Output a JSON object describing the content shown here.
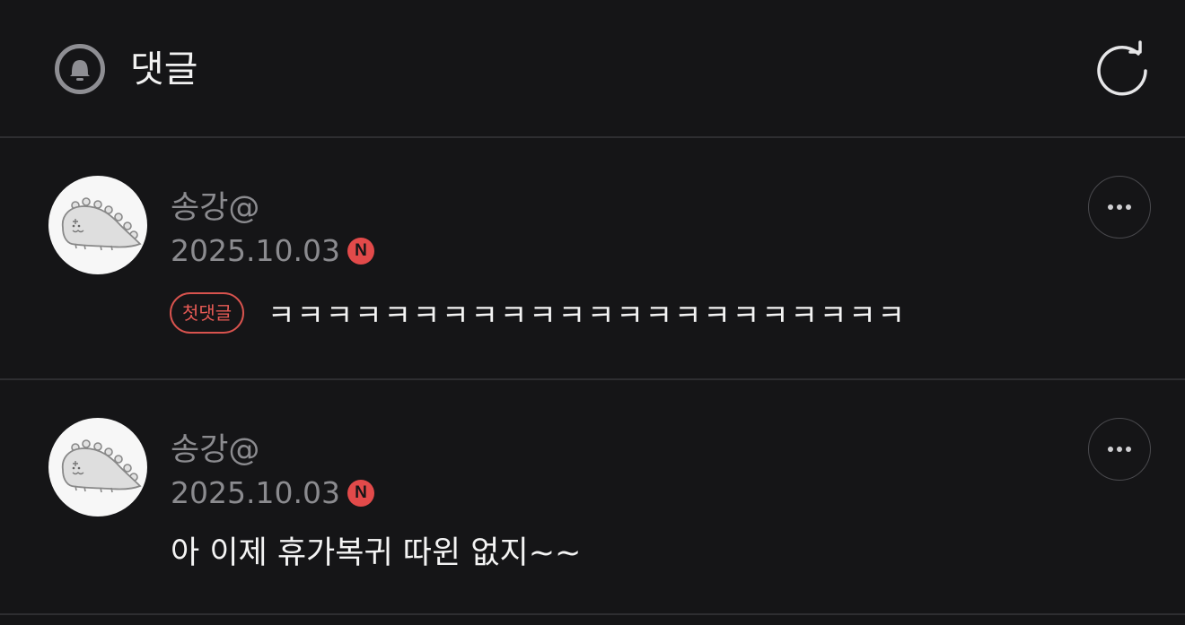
{
  "header": {
    "title": "댓글",
    "icons": [
      "bell-icon",
      "refresh-icon"
    ]
  },
  "comments": [
    {
      "author": "송강@",
      "date": "2025.10.03",
      "badge": "N",
      "tag": "첫댓글",
      "text": "ㅋㅋㅋㅋㅋㅋㅋㅋㅋㅋㅋㅋㅋㅋㅋㅋㅋㅋㅋㅋㅋㅋ",
      "avatar": "dinosaur-avatar-icon"
    },
    {
      "author": "송강@",
      "date": "2025.10.03",
      "badge": "N",
      "text": "아 이제 휴가복귀 따윈 없지~~",
      "avatar": "dinosaur-avatar-icon"
    }
  ],
  "colors": {
    "background": "#151517",
    "divider": "#2e2e31",
    "muted_text": "#8b8b8f",
    "accent_red": "#e24a4a"
  }
}
